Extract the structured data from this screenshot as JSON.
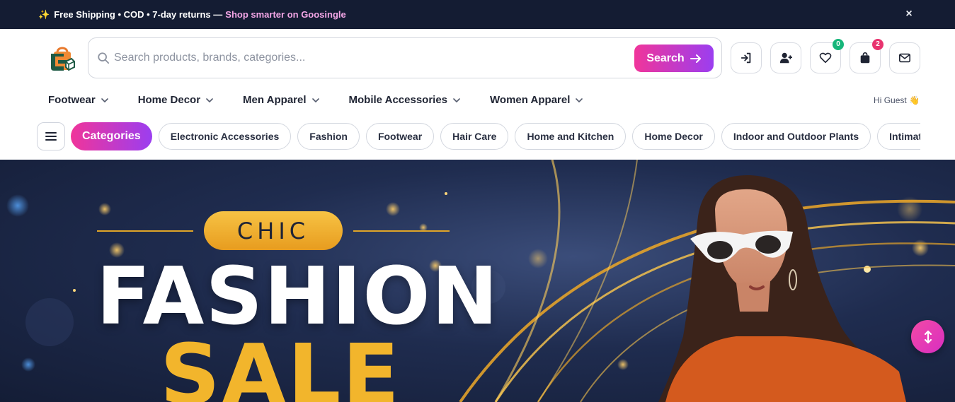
{
  "announcement": {
    "icon": "sparkles-icon",
    "text": "Free Shipping • COD • 7-day returns —",
    "accent_text": "Shop smarter on Goosingle",
    "close_label": "×"
  },
  "header": {
    "logo_icon": "shopping-bag-logo",
    "search": {
      "placeholder": "Search products, brands, categories...",
      "value": "",
      "button_label": "Search",
      "button_icon": "arrow-right-icon"
    },
    "actions": {
      "login_icon": "login-icon",
      "register_icon": "user-plus-icon",
      "wishlist_icon": "heart-icon",
      "wishlist_count": "0",
      "cart_icon": "shopping-bag-icon",
      "cart_count": "2",
      "messages_icon": "envelope-icon"
    }
  },
  "main_nav": {
    "items": [
      {
        "label": "Footwear"
      },
      {
        "label": "Home Decor"
      },
      {
        "label": "Men Apparel"
      },
      {
        "label": "Mobile Accessories"
      },
      {
        "label": "Women Apparel"
      }
    ],
    "greeting": "Hi Guest 👋"
  },
  "category_bar": {
    "menu_icon": "hamburger-menu-icon",
    "categories_label": "Categories",
    "pills": [
      {
        "label": "Electronic Accessories"
      },
      {
        "label": "Fashion"
      },
      {
        "label": "Footwear"
      },
      {
        "label": "Hair Care"
      },
      {
        "label": "Home and Kitchen"
      },
      {
        "label": "Home Decor"
      },
      {
        "label": "Indoor and Outdoor Plants"
      },
      {
        "label": "Intimates"
      }
    ]
  },
  "hero": {
    "tag": "CHIC",
    "headline1": "FASHION",
    "headline2": "SALE",
    "scroll_icon": "scroll-vertical-icon"
  },
  "colors": {
    "announce_bg": "#141c33",
    "accent_pink": "#f0359a",
    "accent_purple": "#9b3ef0",
    "gold": "#f2b52c"
  }
}
